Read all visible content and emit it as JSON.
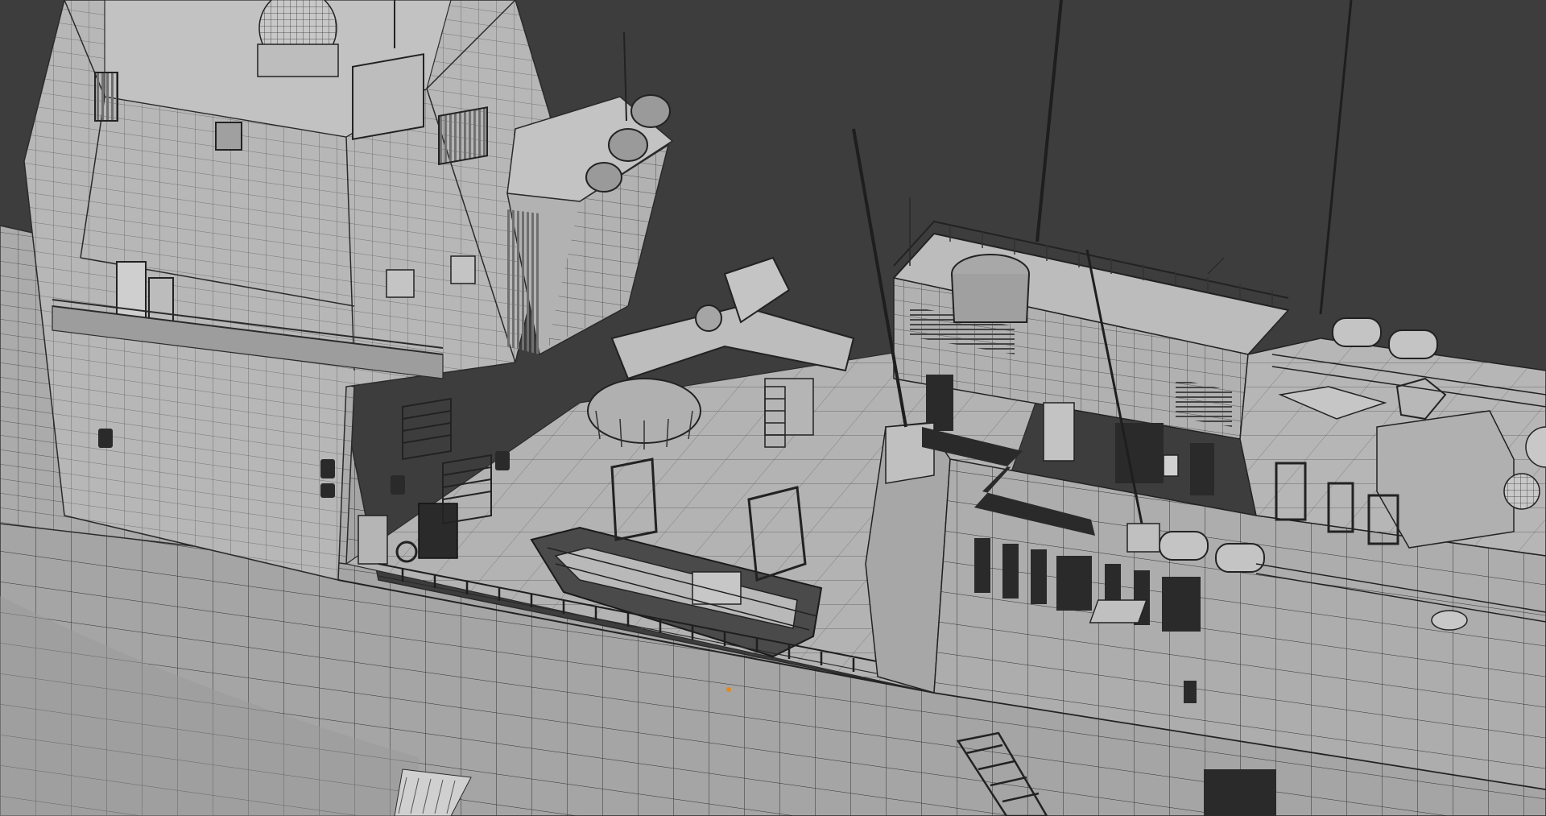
{
  "viewport": {
    "mode": "wireframe-on-shaded",
    "content": "3d-ship-model",
    "colors": {
      "background": "#3d3d3d",
      "hull": "#a9a9a9",
      "hull_shadow": "#7a7a7a",
      "deck": "#b4b4b4",
      "superstructure": "#b9b9b9",
      "wire": "#2b2b2b",
      "dark_panel": "#2a2a2a",
      "highlight": "#cfcfcf",
      "selection_dot": "#e08a20"
    },
    "icons": [
      "selection-vertex-icon"
    ]
  }
}
